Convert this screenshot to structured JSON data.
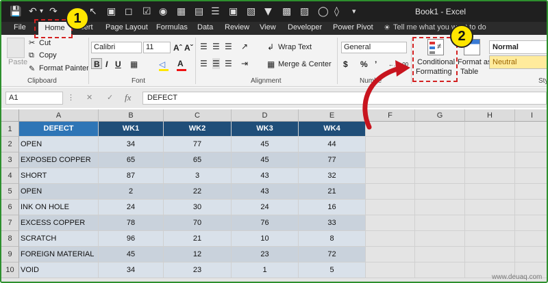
{
  "titlebar": {
    "title": "Book1  -  Excel"
  },
  "qat": {
    "save_icon": "save-icon",
    "undo_icon": "undo-icon",
    "redo_icon": "redo-icon"
  },
  "tabs": [
    {
      "label": "File"
    },
    {
      "label": "Home"
    },
    {
      "label": "Insert"
    },
    {
      "label": "Page Layout"
    },
    {
      "label": "Formulas"
    },
    {
      "label": "Data"
    },
    {
      "label": "Review"
    },
    {
      "label": "View"
    },
    {
      "label": "Developer"
    },
    {
      "label": "Power Pivot"
    }
  ],
  "tellme": "Tell me what you want to do",
  "ribbon": {
    "clipboard": {
      "label": "Clipboard",
      "paste": "Paste",
      "cut": "Cut",
      "copy": "Copy",
      "format_painter": "Format Painter"
    },
    "font": {
      "label": "Font",
      "font_name": "Calibri",
      "font_size": "11",
      "bold": "B",
      "italic": "I",
      "underline": "U"
    },
    "alignment": {
      "label": "Alignment",
      "wrap_text": "Wrap Text",
      "merge_center": "Merge & Center"
    },
    "number": {
      "label": "Numbe",
      "format": "General",
      "currency": "$",
      "percent": "%",
      "comma": "’"
    },
    "styles": {
      "conditional_formatting_1": "Conditional",
      "conditional_formatting_2": "Formatting",
      "format_as_table_1": "Format as",
      "format_as_table_2": "Table",
      "normal": "Normal",
      "neutral": "Neutral",
      "label": "Styl"
    }
  },
  "formula_bar": {
    "name_box": "A1",
    "fx": "fx",
    "content": "DEFECT"
  },
  "columns": [
    "A",
    "B",
    "C",
    "D",
    "E",
    "F",
    "G",
    "H",
    "I"
  ],
  "rows": [
    "1",
    "2",
    "3",
    "4",
    "5",
    "6",
    "7",
    "8",
    "9",
    "10"
  ],
  "table": {
    "headers": [
      "DEFECT",
      "WK1",
      "WK2",
      "WK3",
      "WK4"
    ],
    "data": [
      [
        "OPEN",
        "34",
        "77",
        "45",
        "44"
      ],
      [
        "EXPOSED COPPER",
        "65",
        "65",
        "45",
        "77"
      ],
      [
        "SHORT",
        "87",
        "3",
        "43",
        "32"
      ],
      [
        "OPEN",
        "2",
        "22",
        "43",
        "21"
      ],
      [
        "INK ON HOLE",
        "24",
        "30",
        "24",
        "16"
      ],
      [
        "EXCESS COPPER",
        "78",
        "70",
        "76",
        "33"
      ],
      [
        "SCRATCH",
        "96",
        "21",
        "10",
        "8"
      ],
      [
        "FOREIGN MATERIAL",
        "45",
        "12",
        "23",
        "72"
      ],
      [
        "VOID",
        "34",
        "23",
        "1",
        "5"
      ]
    ]
  },
  "annotations": {
    "step1": "1",
    "step2": "2"
  },
  "watermark": "www.deuaq.com",
  "colors": {
    "header_blue": "#2e75b6",
    "header_dark": "#1f4e79",
    "row_light": "#d9e1ea",
    "row_gray": "#c9d2dc",
    "annotation_red": "#d32020",
    "badge_yellow": "#ffe600"
  }
}
